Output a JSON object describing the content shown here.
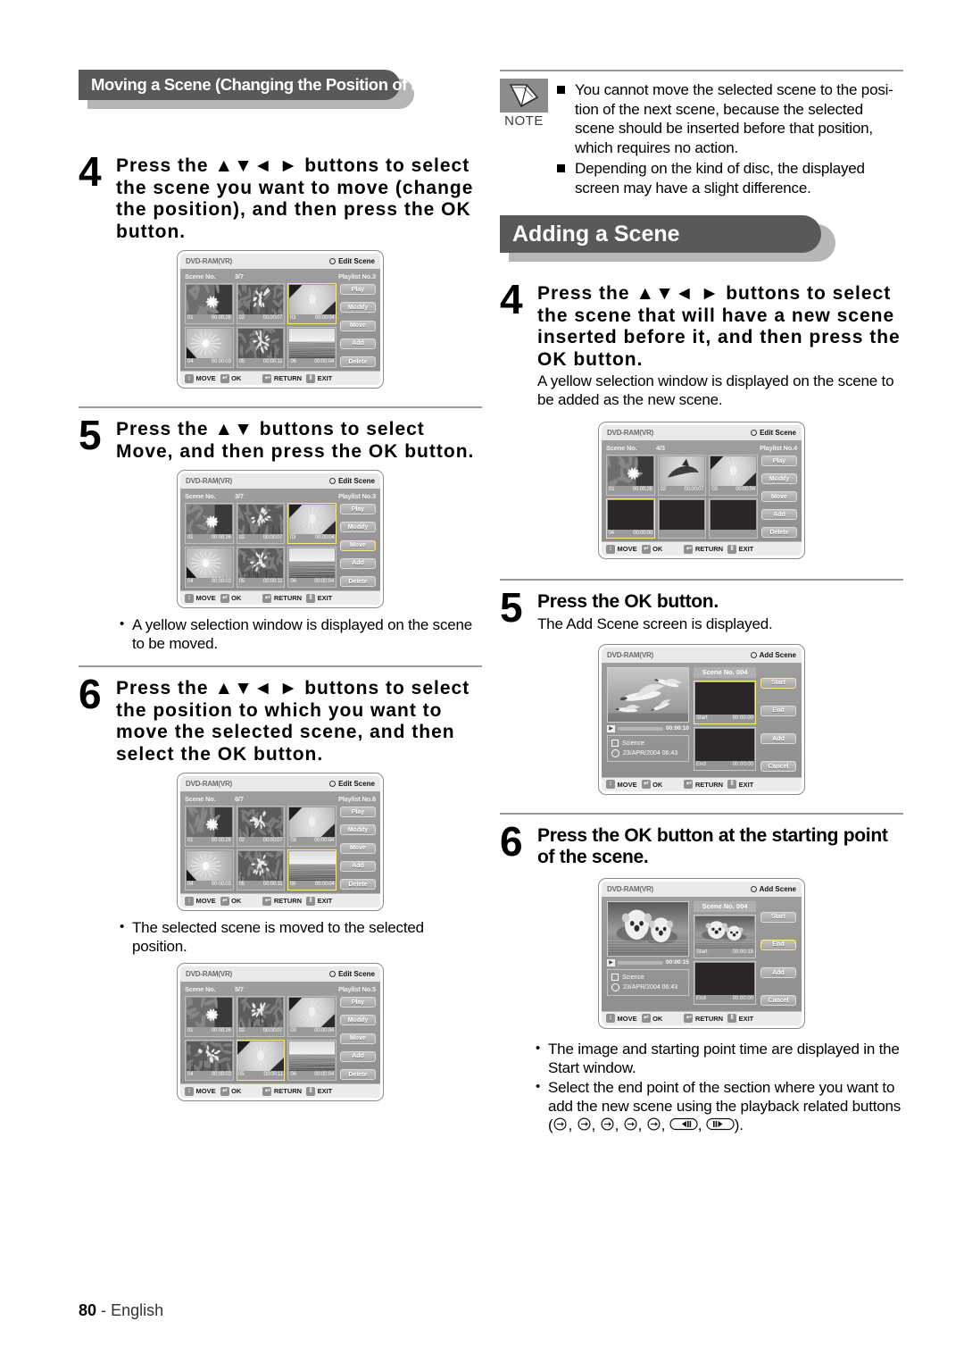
{
  "page": {
    "number": "80",
    "separator": "-",
    "language": "English"
  },
  "left_column": {
    "section_title": "Moving a Scene (Changing the Position of a Scene)",
    "steps": [
      {
        "number": "4",
        "title": "Press the ▲▼◄ ► buttons to select the scene you want to move (change the position), and then press the OK button."
      },
      {
        "number": "5",
        "title": "Press the ▲▼ buttons to select Move, and then press the OK button."
      },
      {
        "number": "6",
        "title": "Press the ▲▼◄ ► buttons to select the position to which you want to move the selected scene, and then select the OK button."
      }
    ],
    "bullet_after_step5": "A yellow selection window is displayed on the scene to be moved.",
    "bullet_after_step6": "The selected scene is moved to the selected position."
  },
  "right_column": {
    "note": {
      "label": "NOTE",
      "icon": "pencil-icon",
      "items": [
        "You cannot move the selected scene to the posi- tion of the next scene, because the selected scene should be inserted before that position, which requires no action.",
        "Depending on the kind of disc, the displayed screen may have a slight difference."
      ]
    },
    "section_title": "Adding a Scene",
    "steps": [
      {
        "number": "4",
        "title": "Press the ▲▼◄ ► buttons to select the scene that will have a new scene inserted before it, and then press the OK button.",
        "sub": "A yellow selection window is displayed on the scene to be added as the new scene."
      },
      {
        "number": "5",
        "title": "Press the OK button.",
        "sub": "The Add Scene screen is displayed."
      },
      {
        "number": "6",
        "title": "Press the OK button at the starting point of the scene.",
        "sub": ""
      }
    ],
    "bullets": [
      "The image and starting point time are displayed in the Start window.",
      "Select the end point of the section where you want to add the new scene using the playback related buttons (   ,   ,   ,   ,   ,       ,       )."
    ]
  },
  "screens": {
    "common": {
      "disc_label": "DVD-RAM(VR)",
      "scene_no_label": "Scene No.",
      "playlist_label": "Playlist No.",
      "gear_icon": "gear-icon",
      "footer": [
        {
          "icon": "updown-arrows-icon",
          "label": "MOVE"
        },
        {
          "icon": "ok-enter-icon",
          "label": "OK"
        },
        {
          "icon": "return-arrow-icon",
          "label": "RETURN"
        },
        {
          "icon": "exit-icon",
          "label": "EXIT"
        }
      ],
      "edit_buttons": [
        "Play",
        "Modify",
        "Move",
        "Add",
        "Delete"
      ],
      "add_buttons": [
        "Start",
        "End",
        "Add",
        "Cancel"
      ]
    },
    "edit_step4": {
      "mode": "Edit Scene",
      "scene_counter": "3/7",
      "playlist_no": "3",
      "selected_index": 2,
      "highlight_button": "",
      "cells": [
        {
          "no": "01",
          "time": "00:00:26",
          "art": "lotus"
        },
        {
          "no": "02",
          "time": "00:00:07",
          "art": "blossom"
        },
        {
          "no": "03",
          "time": "00:00:04",
          "art": "flower"
        },
        {
          "no": "04",
          "time": "00:00:03",
          "art": "daisy"
        },
        {
          "no": "05",
          "time": "00:00:11",
          "art": "blossom"
        },
        {
          "no": "06",
          "time": "00:00:04",
          "art": "sea"
        }
      ]
    },
    "edit_step5": {
      "mode": "Edit Scene",
      "scene_counter": "3/7",
      "playlist_no": "3",
      "selected_index": 2,
      "highlight_button": "Move",
      "cells": [
        {
          "no": "01",
          "time": "00:00:26",
          "art": "lotus"
        },
        {
          "no": "02",
          "time": "00:00:07",
          "art": "blossom"
        },
        {
          "no": "03",
          "time": "00:00:04",
          "art": "flower"
        },
        {
          "no": "04",
          "time": "00:00:03",
          "art": "daisy"
        },
        {
          "no": "05",
          "time": "00:00:11",
          "art": "blossom"
        },
        {
          "no": "06",
          "time": "00:00:04",
          "art": "sea"
        }
      ]
    },
    "edit_step6": {
      "mode": "Edit Scene",
      "scene_counter": "6/7",
      "playlist_no": "6",
      "selected_index": 5,
      "highlight_button": "",
      "cells": [
        {
          "no": "01",
          "time": "00:00:26",
          "art": "lotus"
        },
        {
          "no": "02",
          "time": "00:00:07",
          "art": "blossom"
        },
        {
          "no": "03",
          "time": "00:00:04",
          "art": "flower"
        },
        {
          "no": "04",
          "time": "00:00:03",
          "art": "daisy"
        },
        {
          "no": "05",
          "time": "00:00:11",
          "art": "blossom"
        },
        {
          "no": "06",
          "time": "00:00:04",
          "art": "sea"
        }
      ]
    },
    "edit_result": {
      "mode": "Edit Scene",
      "scene_counter": "5/7",
      "playlist_no": "5",
      "selected_index": 4,
      "highlight_button": "",
      "cells": [
        {
          "no": "01",
          "time": "00:00:26",
          "art": "lotus"
        },
        {
          "no": "02",
          "time": "00:00:07",
          "art": "blossom"
        },
        {
          "no": "03",
          "time": "00:00:04",
          "art": "flower"
        },
        {
          "no": "04",
          "time": "00:00:03",
          "art": "blossom"
        },
        {
          "no": "05",
          "time": "00:00:11",
          "art": "flower"
        },
        {
          "no": "06",
          "time": "00:00:04",
          "art": "sea"
        }
      ]
    },
    "edit_add": {
      "mode": "Edit Scene",
      "scene_counter": "4/3",
      "playlist_no": "4",
      "selected_index": 3,
      "highlight_button": "",
      "cells": [
        {
          "no": "01",
          "time": "00:00:26",
          "art": "lotus"
        },
        {
          "no": "02",
          "time": "00:00:07",
          "art": "dolphin"
        },
        {
          "no": "03",
          "time": "00:00:04",
          "art": "flower"
        },
        {
          "no": "04",
          "time": "00:00:00",
          "art": "blank"
        },
        {
          "no": "",
          "time": "",
          "art": "blank"
        },
        {
          "no": "",
          "time": "",
          "art": "blank"
        }
      ]
    },
    "add_scene_1": {
      "mode": "Add Scene",
      "scene_title": "Scene No. 004",
      "preview_art": "seagulls",
      "play_time": "00:00:10",
      "info_title": "Science",
      "info_date": "23/APR/2004 06:43",
      "start_label": "Start",
      "start_time": "00:00:00",
      "start_art": "blank",
      "end_label": "End",
      "end_time": "00:00:00",
      "end_art": "blank",
      "highlight_button": "Start"
    },
    "add_scene_2": {
      "mode": "Add Scene",
      "scene_title": "Scene No. 004",
      "preview_art": "otters",
      "play_time": "00:00:15",
      "info_title": "Science",
      "info_date": "23/APR/2004 06:43",
      "start_label": "Start",
      "start_time": "00:00:15",
      "start_art": "otters",
      "end_label": "End",
      "end_time": "00:00:00",
      "end_art": "blank",
      "highlight_button": "End"
    }
  }
}
